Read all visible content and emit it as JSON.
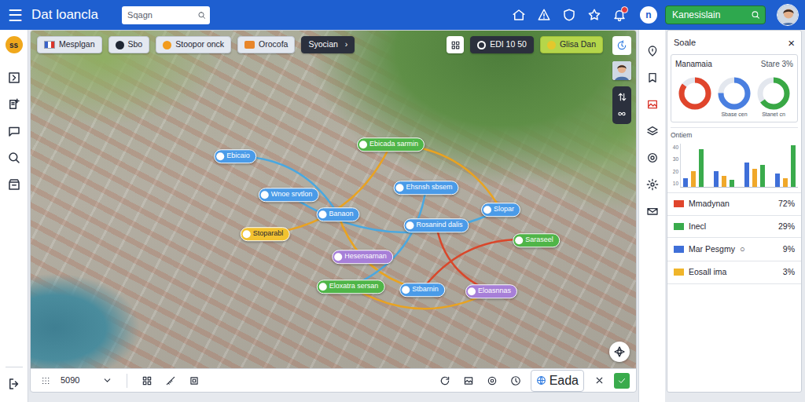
{
  "header": {
    "menu_icon": "☰",
    "title": "Dat loancla",
    "search": {
      "placeholder": "Sqagn"
    },
    "notifications": {
      "unread": true
    },
    "user_initial": "n",
    "quick_search": {
      "value": "Kanesislain"
    }
  },
  "left_rail": {
    "badge": "ss"
  },
  "map": {
    "toolbar_left": [
      {
        "label": "Mesplgan",
        "kind": "light",
        "color": "#3a63c9"
      },
      {
        "label": "Sbo",
        "kind": "light",
        "color": "#1f2633"
      },
      {
        "label": "Stoopor onck",
        "kind": "light",
        "color": "#f29b1d"
      },
      {
        "label": "Orocofa",
        "kind": "light",
        "color": "#e8862a"
      },
      {
        "label": "Syocian",
        "kind": "dark",
        "suffix": "›"
      }
    ],
    "toolbar_right": [
      {
        "label": "EDI 10 50",
        "kind": "dark",
        "color": "#ffffff"
      },
      {
        "label": "Glisa Dan",
        "kind": "accent",
        "color": "#e4c72c"
      }
    ],
    "pins": [
      {
        "label": "Ebicaio",
        "color": "#4a9be8"
      },
      {
        "label": "Ebicada sarmin",
        "color": "#4fb548"
      },
      {
        "label": "Wnoe srvtlon",
        "color": "#4a9be8"
      },
      {
        "label": "Ehsnsh sbsem",
        "color": "#4a9be8"
      },
      {
        "label": "Banaon",
        "color": "#4a9be8"
      },
      {
        "label": "Rosanind dalis",
        "color": "#4a9be8"
      },
      {
        "label": "Slopar",
        "color": "#4a9be8"
      },
      {
        "label": "Stoparabl",
        "color": "#f2c230"
      },
      {
        "label": "Saraseel",
        "color": "#4fb548"
      },
      {
        "label": "Hesensarnan",
        "color": "#a77fd8"
      },
      {
        "label": "Eloxatra sersan",
        "color": "#4fb548"
      },
      {
        "label": "Stbarnin",
        "color": "#4a9be8"
      },
      {
        "label": "Eloasnnas",
        "color": "#a77fd8"
      }
    ],
    "links": [
      {
        "from": 7,
        "to": 1,
        "color": "#e9a321"
      },
      {
        "from": 1,
        "to": 6,
        "color": "#e9a321"
      },
      {
        "from": 2,
        "to": 6,
        "color": "#4aa8e0"
      },
      {
        "from": 0,
        "to": 4,
        "color": "#4aa8e0"
      },
      {
        "from": 4,
        "to": 11,
        "color": "#e9a321"
      },
      {
        "from": 3,
        "to": 10,
        "color": "#4aa8e0"
      },
      {
        "from": 10,
        "to": 12,
        "color": "#e9a321"
      },
      {
        "from": 11,
        "to": 8,
        "color": "#d9472b"
      },
      {
        "from": 5,
        "to": 12,
        "color": "#d9472b"
      }
    ]
  },
  "bottom_bar": {
    "zoom": "5090",
    "layer": "Eada"
  },
  "panel": {
    "title": "Soale",
    "close": "×",
    "summary": {
      "title": "Manamaia",
      "stat": "Stare 3%",
      "donuts": [
        {
          "level": 0.85,
          "color": "#e0452c"
        },
        {
          "level": 0.75,
          "color": "#4a7fe0",
          "label": "Sbase cen"
        },
        {
          "level": 0.65,
          "color": "#39a845",
          "label": "Stanet cn"
        }
      ]
    },
    "chart": {
      "title": "Ontiem",
      "ticks": [
        "40",
        "30",
        "20",
        "10"
      ],
      "series": [
        {
          "color": "#3f6fd8",
          "values": [
            8,
            14,
            22,
            12
          ]
        },
        {
          "color": "#f0a82a",
          "values": [
            14,
            10,
            16,
            8
          ]
        },
        {
          "color": "#3aab4c",
          "values": [
            34,
            6,
            20,
            38
          ]
        }
      ]
    },
    "legend": [
      {
        "label": "Mmadynan",
        "value": "72%",
        "color": "#e0452c"
      },
      {
        "label": "Inecl",
        "value": "29%",
        "color": "#3aab4c"
      },
      {
        "label": "Mar Pesgmy",
        "icon": "○",
        "value": "9%",
        "color": "#3f6fd8"
      },
      {
        "label": "Eosall ima",
        "value": "3%",
        "color": "#f0b52a"
      }
    ]
  }
}
